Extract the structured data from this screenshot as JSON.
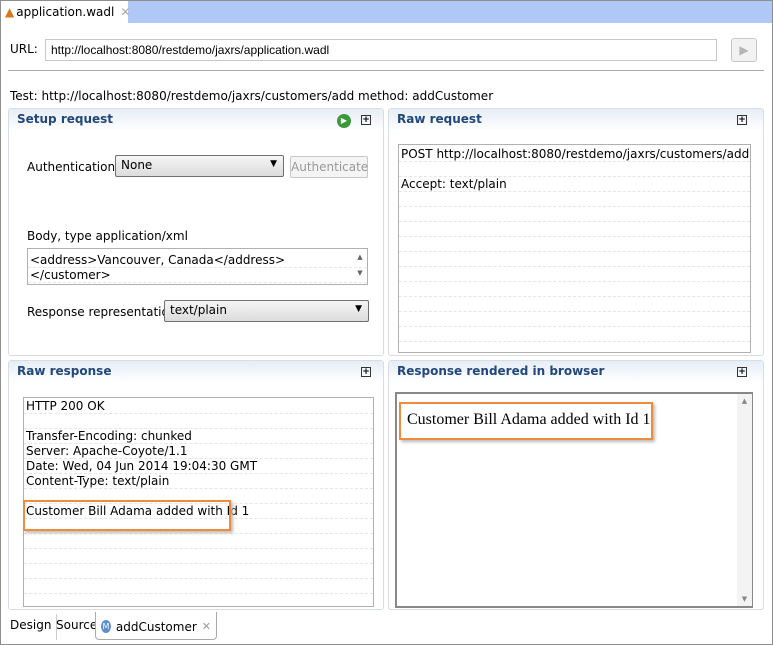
{
  "editor_tab": {
    "title": "application.wadl",
    "icon": "wadl-file-icon"
  },
  "url": {
    "label": "URL:",
    "value": "http://localhost:8080/restdemo/jaxrs/application.wadl",
    "run_icon": "run-icon"
  },
  "test_line": "Test: http://localhost:8080/restdemo/jaxrs/customers/add method: addCustomer",
  "setup": {
    "title": "Setup request",
    "auth_label": "Authentication:",
    "auth_value": "None",
    "authenticate": "Authenticate",
    "body_label": "Body, type application/xml",
    "body_lines": [
      "<address>Vancouver, Canada</address>",
      "</customer>"
    ],
    "repr_label": "Response representation:",
    "repr_value": "text/plain"
  },
  "raw_request": {
    "title": "Raw request",
    "lines": [
      "POST http://localhost:8080/restdemo/jaxrs/customers/add",
      "",
      "Accept: text/plain"
    ]
  },
  "raw_response": {
    "title": "Raw response",
    "lines": [
      "HTTP 200 OK",
      "",
      "Transfer-Encoding: chunked",
      "Server: Apache-Coyote/1.1",
      "Date: Wed, 04 Jun 2014 19:04:30 GMT",
      "Content-Type: text/plain",
      "",
      "Customer Bill Adama added with Id 1"
    ]
  },
  "rendered": {
    "title": "Response rendered in browser",
    "text": "Customer Bill Adama added with Id 1"
  },
  "bottom_tabs": {
    "design": "Design",
    "source": "Source",
    "active": "addCustomer"
  },
  "colors": {
    "highlight": "#f08a3c",
    "panel_title": "#22477b",
    "tab_bar": "#b0c8f5"
  }
}
